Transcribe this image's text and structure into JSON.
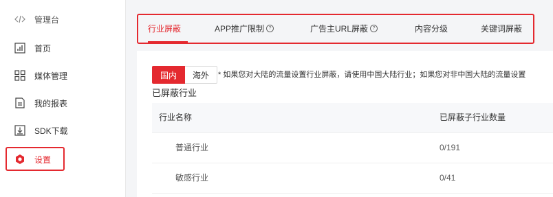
{
  "sidebar": {
    "items": [
      {
        "label": "管理台",
        "icon": "code-icon"
      },
      {
        "label": "首页",
        "icon": "bar-chart-icon"
      },
      {
        "label": "媒体管理",
        "icon": "grid-icon"
      },
      {
        "label": "我的报表",
        "icon": "document-icon"
      },
      {
        "label": "SDK下载",
        "icon": "download-icon"
      },
      {
        "label": "设置",
        "icon": "settings-hexagon-icon"
      }
    ]
  },
  "tabs": [
    {
      "label": "行业屏蔽",
      "help": false
    },
    {
      "label": "APP推广限制",
      "help": true
    },
    {
      "label": "广告主URL屏蔽",
      "help": true
    },
    {
      "label": "内容分级",
      "help": false
    },
    {
      "label": "关键词屏蔽",
      "help": false
    }
  ],
  "help_glyph": "?",
  "region": {
    "domestic": "国内",
    "overseas": "海外"
  },
  "notice": "* 如果您对大陆的流量设置行业屏蔽，请使用中国大陆行业；如果您对非中国大陆的流量设置",
  "section_title": "已屏蔽行业",
  "table": {
    "headers": [
      "行业名称",
      "已屏蔽子行业数量"
    ],
    "rows": [
      [
        "普通行业",
        "0/191"
      ],
      [
        "敏感行业",
        "0/41"
      ]
    ]
  },
  "colors": {
    "accent": "#e4292f"
  }
}
